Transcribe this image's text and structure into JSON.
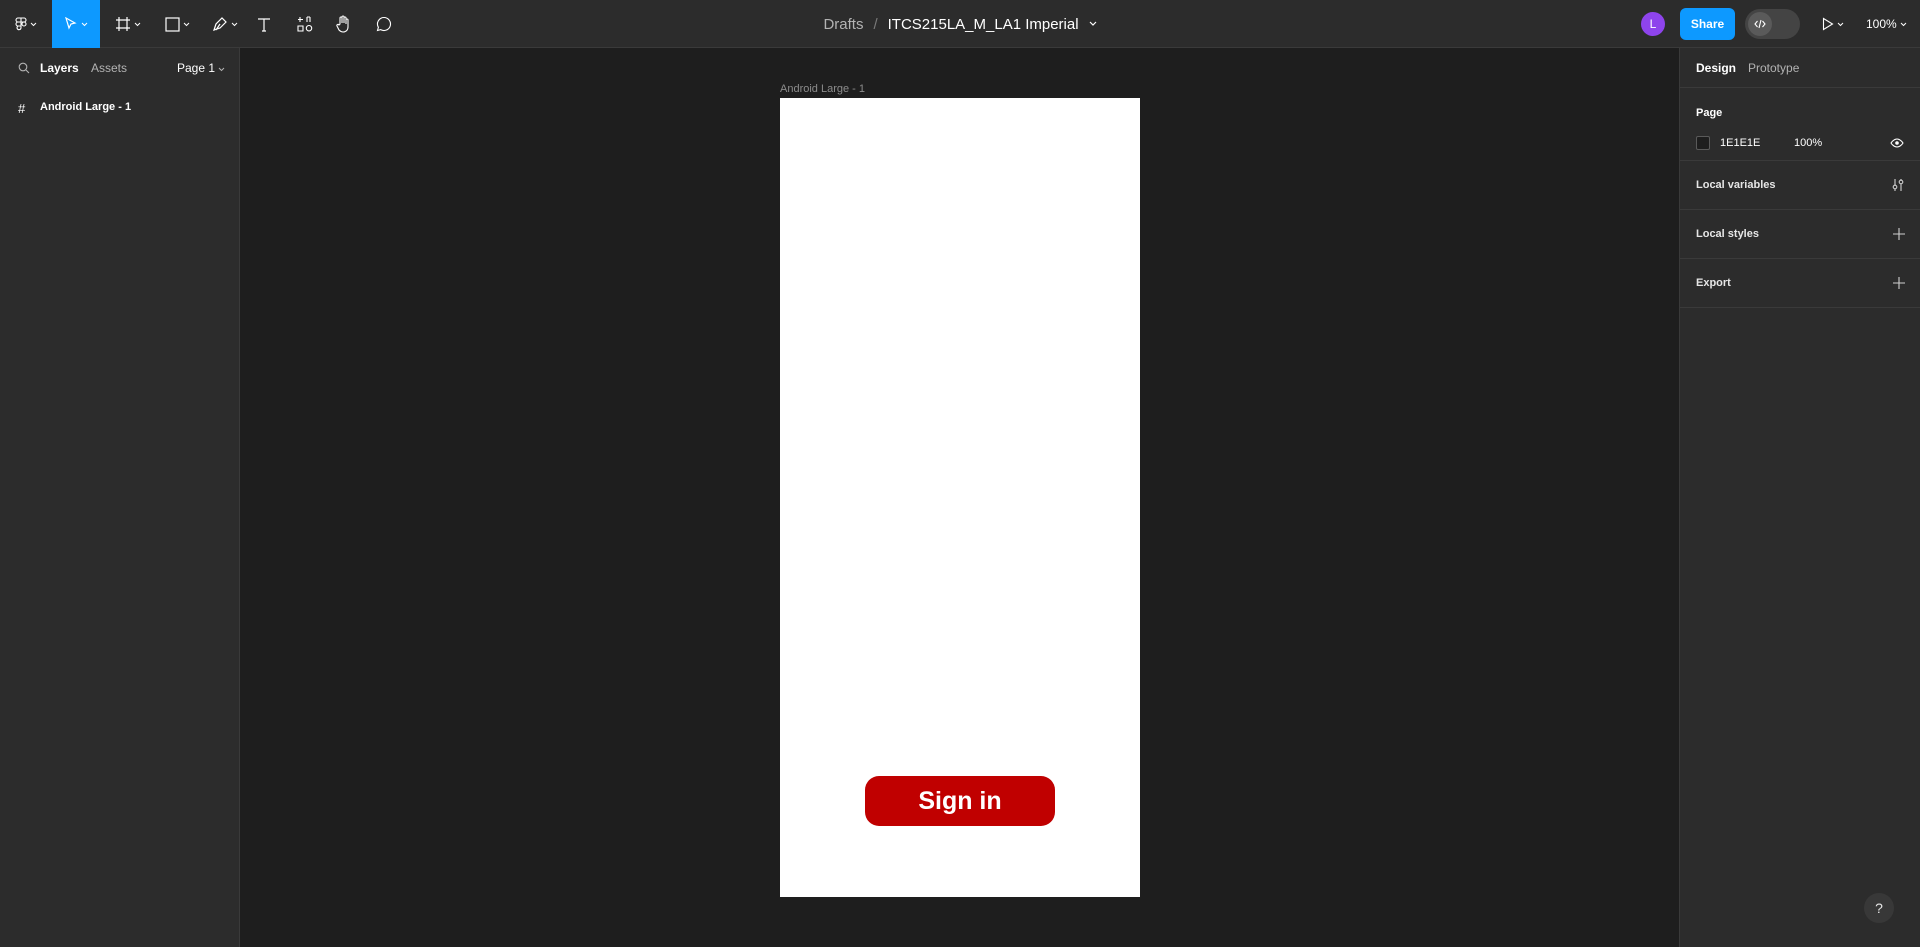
{
  "toolbar": {
    "breadcrumb": "Drafts",
    "separator": "/",
    "filename": "ITCS215LA_M_LA1 Imperial",
    "avatar_initial": "L",
    "share_label": "Share",
    "zoom_label": "100%"
  },
  "left_panel": {
    "tabs": {
      "layers": "Layers",
      "assets": "Assets"
    },
    "page_selector": "Page 1",
    "layers": [
      {
        "name": "Android Large - 1"
      }
    ]
  },
  "canvas": {
    "frame_label": "Android Large - 1",
    "button_label": "Sign in",
    "button_color": "#c00000"
  },
  "right_panel": {
    "tabs": {
      "design": "Design",
      "prototype": "Prototype"
    },
    "page_title": "Page",
    "page_color_hex": "1E1E1E",
    "page_opacity": "100%",
    "sections": {
      "local_variables": "Local variables",
      "local_styles": "Local styles",
      "export": "Export"
    }
  },
  "help_label": "?"
}
